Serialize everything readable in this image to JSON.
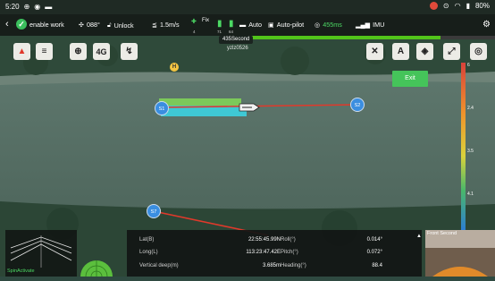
{
  "status": {
    "time": "5:20",
    "battery": "80%"
  },
  "topbar": {
    "work_label": "enable work",
    "heading": "088°",
    "lock_label": "Unlock",
    "speed": "1.5m/s",
    "fix_label": "Fix",
    "fix_count": "4",
    "bat1_sub": "71",
    "bat2_sub": "64",
    "auto_label": "Auto",
    "autopilot_label": "Auto-pilot",
    "latency": "455ms",
    "imu_label": "IMU"
  },
  "timer": "435Second",
  "boat_id": "yzlz0526",
  "progress": 0.8,
  "tools": {
    "btn4g": "4G"
  },
  "exit_label": "Exit",
  "legend_ticks": [
    "6",
    "2.4",
    "3.5",
    "4.1"
  ],
  "waypoints": [
    "S1",
    "S2",
    "S7"
  ],
  "info": {
    "lat_label": "Lat(B)",
    "lat_value": "22:55:45.99N",
    "lon_label": "Long(L)",
    "lon_value": "113:23:47.42E",
    "depth_label": "Vertical deep(m)",
    "depth_value": "3.685m",
    "roll_label": "Roll(°)",
    "roll_value": "0.014°",
    "pitch_label": "Pitch(°)",
    "pitch_value": "0.072°",
    "heading_label": "Heading(°)",
    "heading_value": "88.4"
  },
  "sonar_caption": "SpinActivate",
  "camera_label": "Front Second",
  "colors": {
    "accent_green": "#52c41a",
    "route_red": "#e0392b",
    "waypoint_blue": "#3a8ee0"
  }
}
